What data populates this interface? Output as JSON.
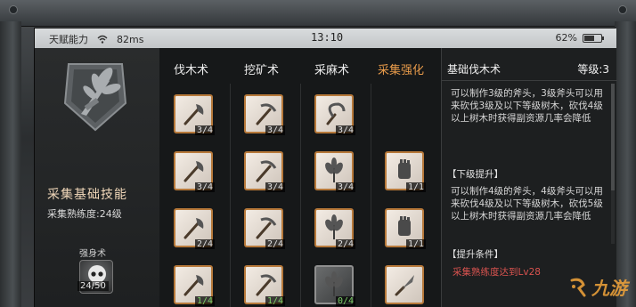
{
  "status_bar": {
    "carrier": "天赋能力",
    "ping": "82ms",
    "time": "13:10",
    "battery": "62%",
    "battery_level": 0.62
  },
  "left_panel": {
    "emblem_icon": "herb-bundle-emblem-icon",
    "skill_title": "采集基础技能",
    "skill_level": "采集熟练度:24级",
    "sub_skill": {
      "label": "强身术",
      "icon": "skull-avatar-icon",
      "count": "24/50"
    }
  },
  "tabs": [
    {
      "label": "伐木术",
      "active": false
    },
    {
      "label": "挖矿术",
      "active": false
    },
    {
      "label": "采麻术",
      "active": false
    },
    {
      "label": "采集强化",
      "active": true
    }
  ],
  "grid": [
    [
      {
        "icon": "axe-icon",
        "count": "3/4",
        "style": "light",
        "green": false
      },
      {
        "icon": "pickaxe-icon",
        "count": "3/4",
        "style": "light",
        "green": false
      },
      {
        "icon": "sickle-icon",
        "count": "3/4",
        "style": "light",
        "green": false
      },
      null
    ],
    [
      {
        "icon": "axe-icon",
        "count": "3/4",
        "style": "light",
        "green": false
      },
      {
        "icon": "pickaxe-icon",
        "count": "3/4",
        "style": "light",
        "green": false
      },
      {
        "icon": "herb-icon",
        "count": "3/4",
        "style": "light",
        "green": false
      },
      {
        "icon": "glove-icon",
        "count": "1/1",
        "style": "light",
        "green": false
      }
    ],
    [
      {
        "icon": "axe-icon",
        "count": "2/4",
        "style": "light",
        "green": false
      },
      {
        "icon": "pickaxe-icon",
        "count": "2/4",
        "style": "light",
        "green": false
      },
      {
        "icon": "herb-icon",
        "count": "2/4",
        "style": "light",
        "green": false
      },
      {
        "icon": "glove-icon",
        "count": "1/1",
        "style": "light",
        "green": false
      }
    ],
    [
      {
        "icon": "axe-icon",
        "count": "1/4",
        "style": "light",
        "green": true
      },
      {
        "icon": "pickaxe-icon",
        "count": "1/4",
        "style": "light",
        "green": true
      },
      {
        "icon": "herb-icon",
        "count": "0/4",
        "style": "dark",
        "green": true
      },
      {
        "icon": "knife-icon",
        "count": "",
        "style": "light",
        "green": false
      }
    ]
  ],
  "detail": {
    "title": "基础伐木术",
    "level": "等级:3",
    "description": "可以制作3级的斧头，3级斧头可以用来砍伐3级及以下等级树木，砍伐4级以上树木时获得副资源几率会降低",
    "next_level_header": "【下级提升】",
    "next_level_desc": "可以制作4级的斧头，4级斧头可以用来砍伐4级及以下等级树木，砍伐5级以上树木时获得副资源几率会降低",
    "requirement_header": "【提升条件】",
    "requirement": "采集熟练度达到Lv28"
  },
  "watermark": "九游",
  "colors": {
    "accent": "#e79a4a",
    "tile_border": "#b7793a",
    "requirement_red": "#d9534f",
    "count_green": "#7ed36a"
  }
}
